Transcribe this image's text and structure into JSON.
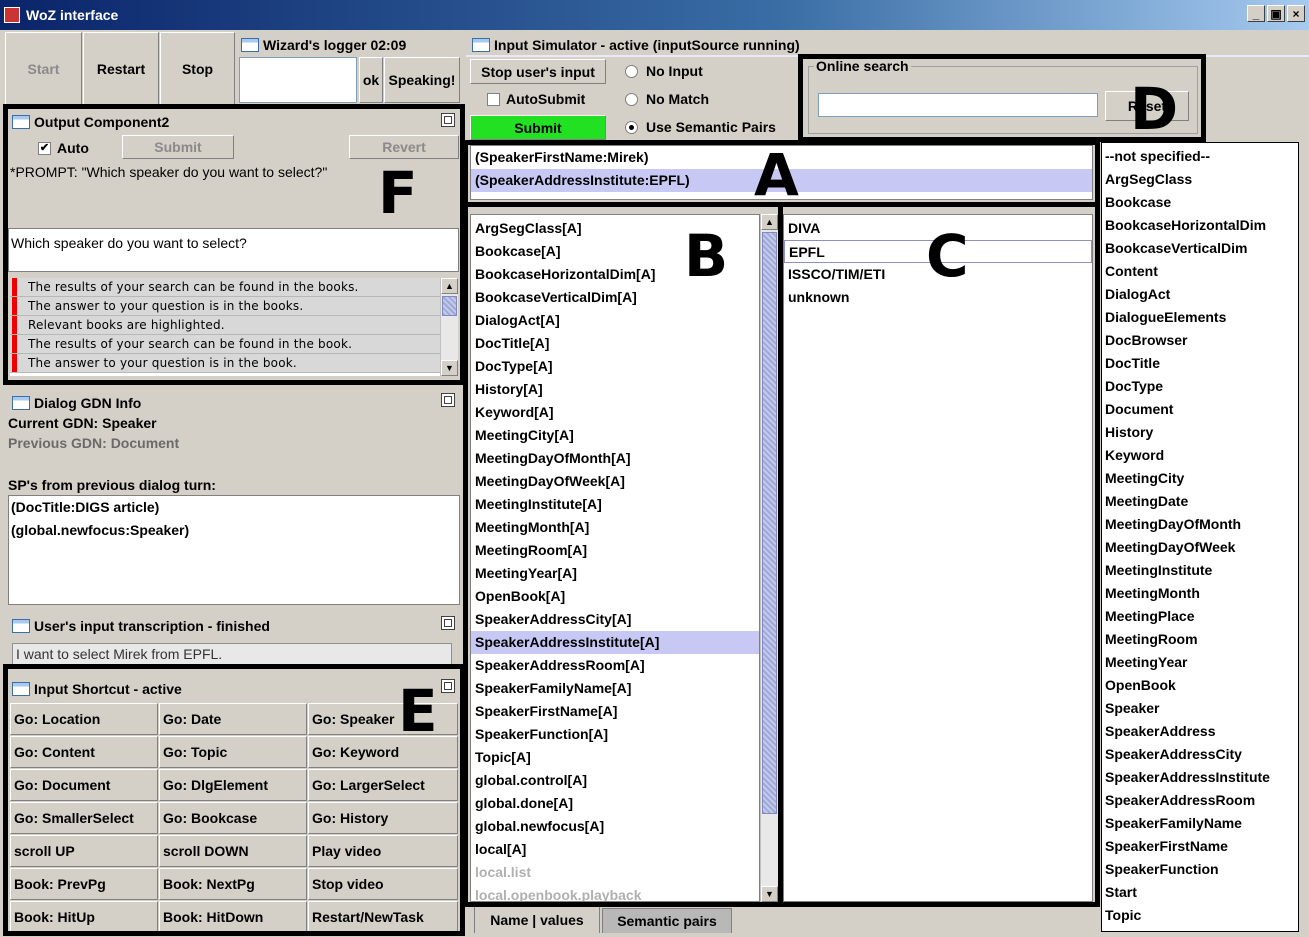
{
  "window": {
    "title": "WoZ interface",
    "controls": [
      "_",
      "▣",
      "×"
    ]
  },
  "control_bar": {
    "start": "Start",
    "restart": "Restart",
    "stop": "Stop"
  },
  "logger": {
    "title": "Wizard's logger 02:09",
    "input_value": "",
    "ok": "ok",
    "speaking": "Speaking!"
  },
  "output_component": {
    "title": "Output Component2",
    "auto_label": "Auto",
    "auto_checked": "✔",
    "submit": "Submit",
    "revert": "Revert",
    "prompt_text": "*PROMPT: \"Which speaker do you want to select?\"",
    "edit_text": "Which speaker do you want to select?",
    "messages": [
      "The results of your search can be found in the books.",
      "The answer to your question is in the books.",
      "Relevant books are highlighted.",
      "The results of your search can be found in the book.",
      "The answer to your question is in the book."
    ]
  },
  "dialog_gdn": {
    "title": "Dialog GDN Info",
    "current": "Current GDN: Speaker",
    "previous": "Previous GDN: Document",
    "sp_label": "SP's from previous dialog turn:",
    "sp_items": [
      "(DocTitle:DIGS article)",
      "(global.newfocus:Speaker)"
    ]
  },
  "transcription": {
    "title": "User's input transcription - finished",
    "text": "I want to select Mirek from EPFL."
  },
  "shortcuts": {
    "title": "Input Shortcut - active",
    "buttons": [
      [
        "Go: Location",
        "Go: Date",
        "Go: Speaker"
      ],
      [
        "Go: Content",
        "Go: Topic",
        "Go: Keyword"
      ],
      [
        "Go: Document",
        "Go: DlgElement",
        "Go: LargerSelect"
      ],
      [
        "Go: SmallerSelect",
        "Go: Bookcase",
        "Go: History"
      ],
      [
        "scroll UP",
        "scroll DOWN",
        "Play video"
      ],
      [
        "Book: PrevPg",
        "Book: NextPg",
        "Stop video"
      ],
      [
        "Book: HitUp",
        "Book: HitDown",
        "Restart/NewTask"
      ]
    ]
  },
  "input_simulator": {
    "title": "Input Simulator - active (inputSource running)",
    "stop_users_input": "Stop user's input",
    "autosubmit": "AutoSubmit",
    "submit": "Submit",
    "radios": [
      "No Input",
      "No Match",
      "Use Semantic Pairs"
    ],
    "selected_radio": "Use Semantic Pairs"
  },
  "online_search": {
    "title": "Online search",
    "value": "",
    "reset": "Reset"
  },
  "semantic_pairs": [
    "(SpeakerFirstName:Mirek)",
    "(SpeakerAddressInstitute:EPFL)"
  ],
  "attributes": [
    "ArgSegClass[A]",
    "Bookcase[A]",
    "BookcaseHorizontalDim[A]",
    "BookcaseVerticalDim[A]",
    "DialogAct[A]",
    "DocTitle[A]",
    "DocType[A]",
    "History[A]",
    "Keyword[A]",
    "MeetingCity[A]",
    "MeetingDayOfMonth[A]",
    "MeetingDayOfWeek[A]",
    "MeetingInstitute[A]",
    "MeetingMonth[A]",
    "MeetingRoom[A]",
    "MeetingYear[A]",
    "OpenBook[A]",
    "SpeakerAddressCity[A]",
    "SpeakerAddressInstitute[A]",
    "SpeakerAddressRoom[A]",
    "SpeakerFamilyName[A]",
    "SpeakerFirstName[A]",
    "SpeakerFunction[A]",
    "Topic[A]",
    "global.control[A]",
    "global.done[A]",
    "global.newfocus[A]",
    "local[A]",
    "local.list",
    "local.openbook.playback"
  ],
  "attribute_selected": "SpeakerAddressInstitute[A]",
  "values": [
    "DIVA",
    "EPFL",
    "ISSCO/TIM/ETI",
    "unknown"
  ],
  "value_selected": "EPFL",
  "tabs": [
    "Name | values",
    "Semantic pairs"
  ],
  "gdn_list": [
    "--not specified--",
    "ArgSegClass",
    "Bookcase",
    "BookcaseHorizontalDim",
    "BookcaseVerticalDim",
    "Content",
    "DialogAct",
    "DialogueElements",
    "DocBrowser",
    "DocTitle",
    "DocType",
    "Document",
    "History",
    "Keyword",
    "MeetingCity",
    "MeetingDate",
    "MeetingDayOfMonth",
    "MeetingDayOfWeek",
    "MeetingInstitute",
    "MeetingMonth",
    "MeetingPlace",
    "MeetingRoom",
    "MeetingYear",
    "OpenBook",
    "Speaker",
    "SpeakerAddress",
    "SpeakerAddressCity",
    "SpeakerAddressInstitute",
    "SpeakerAddressRoom",
    "SpeakerFamilyName",
    "SpeakerFirstName",
    "SpeakerFunction",
    "Start",
    "Topic"
  ],
  "annotations": [
    "A",
    "B",
    "C",
    "D",
    "E",
    "F"
  ],
  "colors": {
    "submit_green": "#22e022",
    "selection": "#c8c8f4",
    "flag_red": "#e00000"
  }
}
